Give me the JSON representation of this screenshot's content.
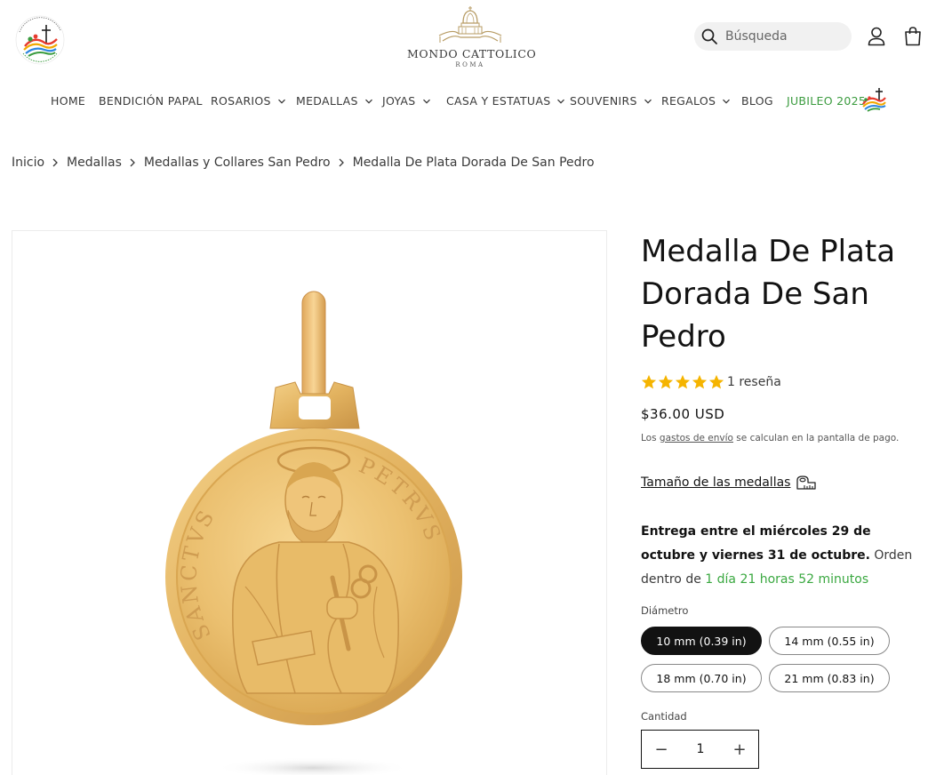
{
  "header": {
    "jubilee_logo_text": "OFFICIAL LICENSEE · PEREGRINANTES IN SPEM · IUBILAEUM A.D. MMXXV",
    "brand_name": "MONDO CATTOLICO",
    "brand_sub": "ROMA",
    "search_placeholder": "Búsqueda",
    "account_icon": "user-icon",
    "cart_icon": "shopping-bag-icon"
  },
  "nav": {
    "items": [
      {
        "label": "HOME",
        "has_dropdown": false
      },
      {
        "label": "BENDICIÓN PAPAL",
        "has_dropdown": false
      },
      {
        "label": "ROSARIOS",
        "has_dropdown": true
      },
      {
        "label": "MEDALLAS",
        "has_dropdown": true
      },
      {
        "label": "JOYAS",
        "has_dropdown": true
      },
      {
        "label": "CASA Y ESTATUAS",
        "has_dropdown": true
      },
      {
        "label": "SOUVENIRS",
        "has_dropdown": true
      },
      {
        "label": "REGALOS",
        "has_dropdown": true
      },
      {
        "label": "BLOG",
        "has_dropdown": false
      },
      {
        "label": "JUBILEO 2025",
        "has_dropdown": false
      }
    ],
    "highlight_color": "#3a9b3e"
  },
  "breadcrumb": {
    "items": [
      "Inicio",
      "Medallas",
      "Medallas y Collares San Pedro",
      "Medalla De Plata Dorada De San Pedro"
    ]
  },
  "product": {
    "title": "Medalla De Plata Dorada De San Pedro",
    "rating": 5,
    "rating_text": "1 reseña",
    "price": "$36.00 USD",
    "shipping_prefix": "Los ",
    "shipping_link": "gastos de envío",
    "shipping_suffix": " se calculan en la pantalla de pago.",
    "size_guide_label": "Tamaño de las medallas",
    "delivery_bold": "Entrega entre el miércoles 29 de octubre y viernes 31 de octubre.",
    "delivery_normal": " Orden dentro de ",
    "delivery_countdown": "1 día 21 horas 52 minutos",
    "diameter_label": "Diámetro",
    "diameter_options": [
      {
        "label": "10 mm (0.39 in)",
        "selected": true
      },
      {
        "label": "14 mm (0.55 in)",
        "selected": false
      },
      {
        "label": "18 mm (0.70 in)",
        "selected": false
      },
      {
        "label": "21 mm (0.83 in)",
        "selected": false
      }
    ],
    "quantity_label": "Cantidad",
    "quantity_value": "1",
    "qty_minus": "−",
    "qty_plus": "+",
    "medal_inscription_left": "SANCTVS",
    "medal_inscription_right": "PETRVS",
    "star_color": "#f5b400",
    "gold_color": "#e9be6a"
  }
}
